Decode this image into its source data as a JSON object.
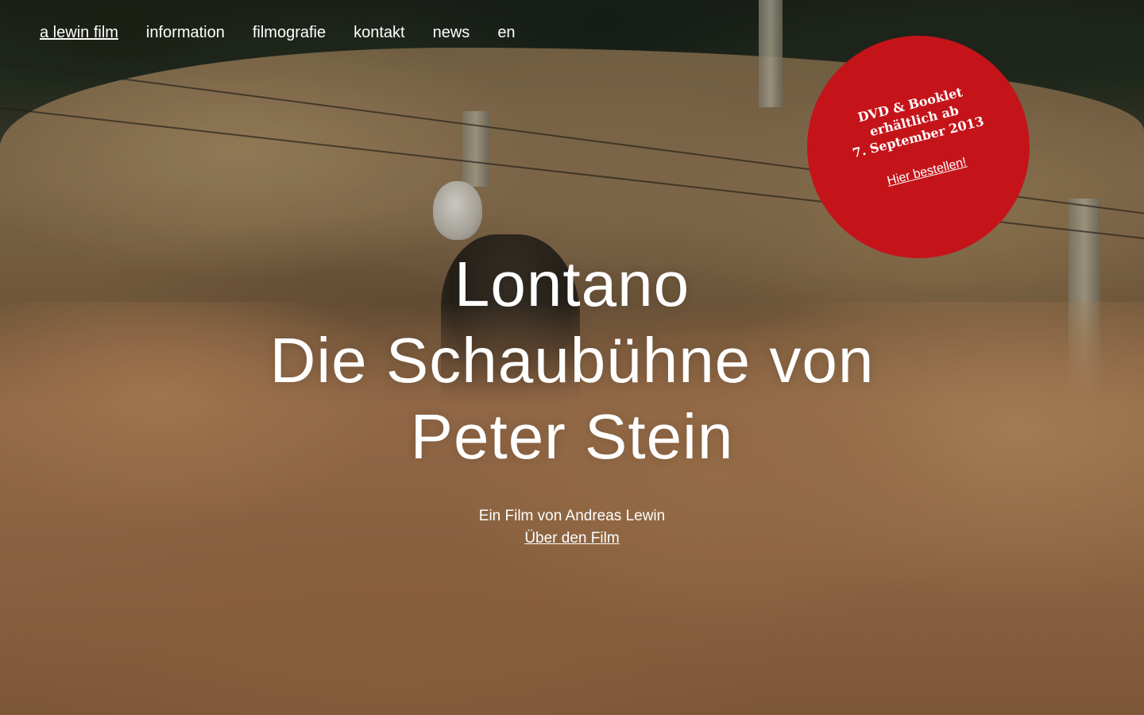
{
  "nav": {
    "items": [
      {
        "label": "a lewin film",
        "active": true
      },
      {
        "label": "information",
        "active": false
      },
      {
        "label": "filmografie",
        "active": false
      },
      {
        "label": "kontakt",
        "active": false
      },
      {
        "label": "news",
        "active": false
      },
      {
        "label": "en",
        "active": false
      }
    ]
  },
  "badge": {
    "line1": "DVD & Booklet",
    "line2": "erhältlich ab",
    "line3": "7. September 2013",
    "link": "Hier bestellen!",
    "color": "#c4141a"
  },
  "hero": {
    "title_line1": "Lontano",
    "title_line2": "Die Schaubühne von",
    "title_line3": "Peter Stein",
    "subtitle": "Ein Film von Andreas Lewin",
    "link": "Über den Film"
  },
  "colors": {
    "text": "#ffffff",
    "accent": "#c4141a"
  }
}
